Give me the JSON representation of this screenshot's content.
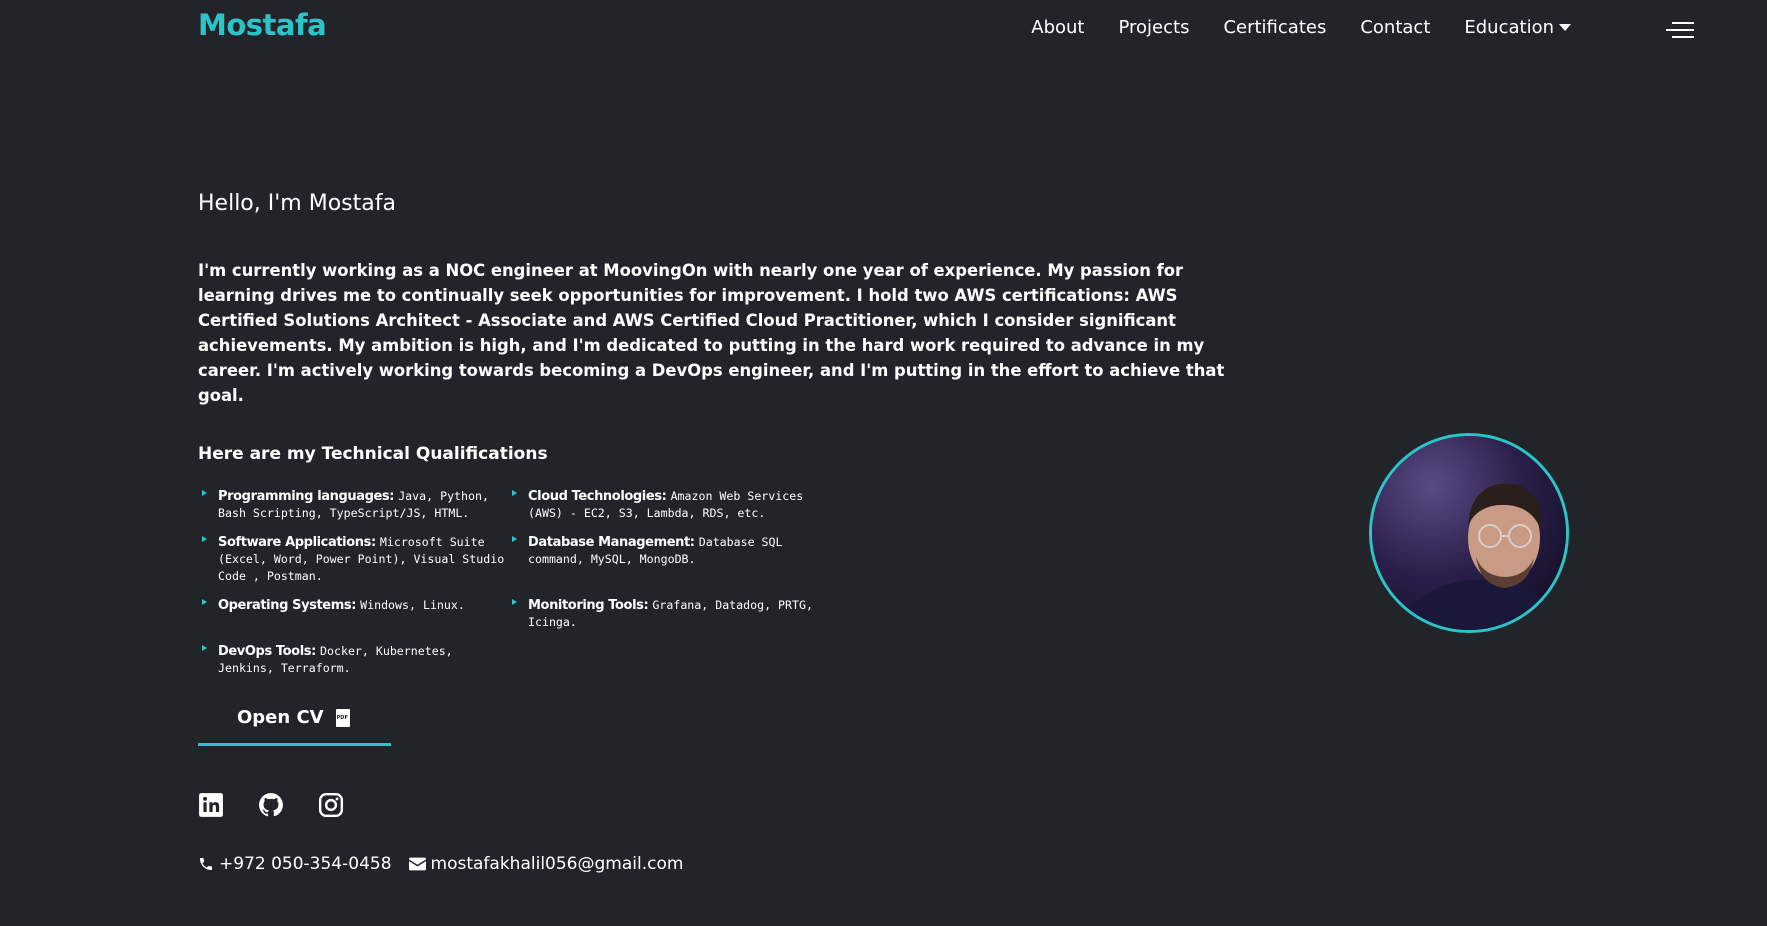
{
  "nav": {
    "brand": "Mostafa",
    "links": [
      "About",
      "Projects",
      "Certificates",
      "Contact",
      "Education"
    ],
    "hamburger_icon": "hamburger-menu-icon",
    "dropdown_icon": "caret-down-icon"
  },
  "hero": {
    "greeting": "Hello, I'm Mostafa",
    "bio": "I'm currently working as a NOC engineer at MoovingOn with nearly one year of experience. My passion for learning drives me to continually seek opportunities for improvement. I hold two AWS certifications: AWS Certified Solutions Architect - Associate and AWS Certified Cloud Practitioner, which I consider significant achievements. My ambition is high, and I'm dedicated to putting in the hard work required to advance in my career. I'm actively working towards becoming a DevOps engineer, and I'm putting in the effort to achieve that goal."
  },
  "qualifications": {
    "title": "Here are my Technical Qualifications",
    "items": [
      {
        "label": "Programming languages:",
        "value": "Java, Python, Bash Scripting, TypeScript/JS, HTML."
      },
      {
        "label": "Cloud Technologies:",
        "value": "Amazon Web Services (AWS) - EC2, S3, Lambda, RDS, etc."
      },
      {
        "label": "Software Applications:",
        "value": "Microsoft Suite (Excel, Word, Power Point), Visual Studio Code , Postman."
      },
      {
        "label": "Database Management:",
        "value": "Database SQL command, MySQL, MongoDB."
      },
      {
        "label": "Operating Systems:",
        "value": "Windows, Linux."
      },
      {
        "label": "Monitoring Tools:",
        "value": "Grafana, Datadog, PRTG, Icinga."
      },
      {
        "label": "DevOps Tools:",
        "value": "Docker, Kubernetes, Jenkins, Terraform."
      }
    ]
  },
  "cv": {
    "label": "Open CV",
    "icon": "pdf-file-icon"
  },
  "socials": [
    "linkedin-icon",
    "github-icon",
    "instagram-icon"
  ],
  "contact": {
    "phone": "+972 050-354-0458",
    "email": "mostafakhalil056@gmail.com"
  },
  "colors": {
    "accent": "#2bc5c9",
    "background": "#212529",
    "text": "#ffffff"
  }
}
